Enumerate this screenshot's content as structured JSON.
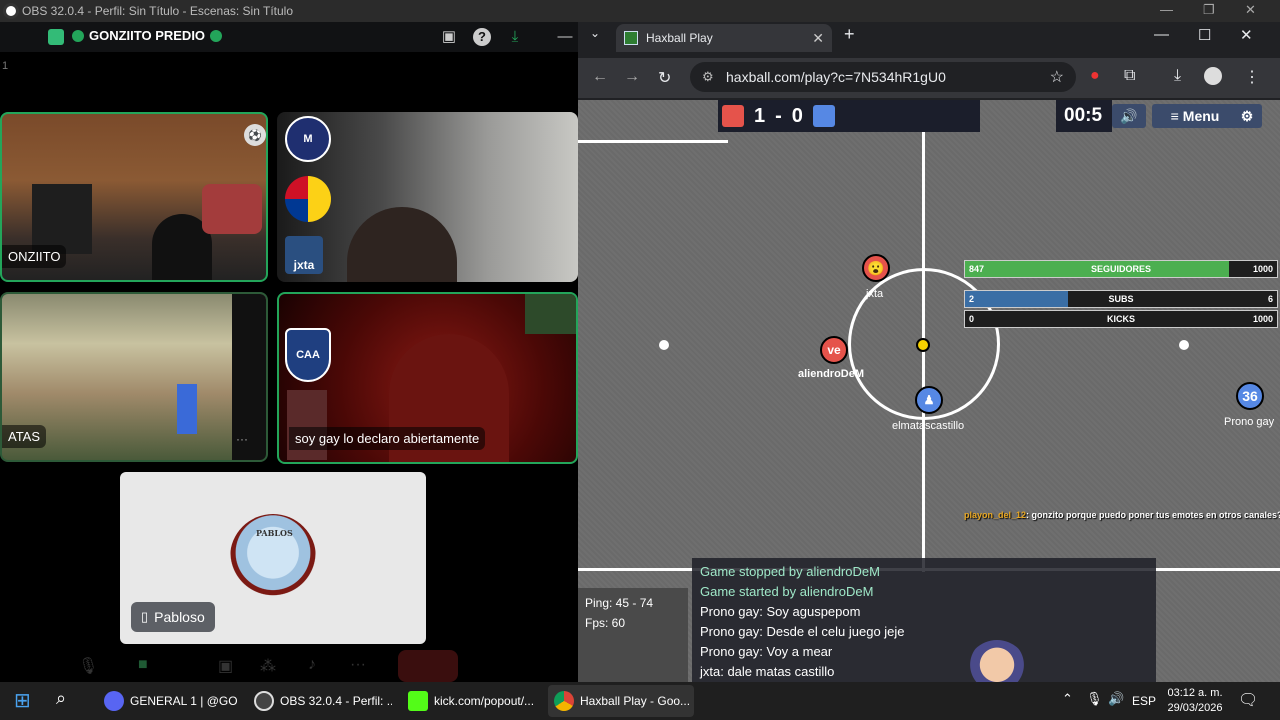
{
  "obs": {
    "title": "OBS 32.0.4 - Perfil: Sin Título - Escenas: Sin Título",
    "minimize": "—",
    "restore": "❐",
    "close": "✕"
  },
  "discord": {
    "channel_suffix": "1",
    "user_name": "GONZIITO PREDIO",
    "tiles": [
      {
        "name": "ONZIITO"
      },
      {
        "name": "jxta"
      },
      {
        "name": "ATAS"
      },
      {
        "name": "soy gay lo declaro abiertamente"
      }
    ],
    "pabloso": {
      "name": "Pabloso",
      "avatar_text": "PABLOS"
    }
  },
  "browser": {
    "tab_title": "Haxball Play",
    "url": "haxball.com/play?c=7N534hR1gU0",
    "new_tab": "+",
    "minimize": "—",
    "maximize": "☐",
    "close": "✕"
  },
  "game": {
    "score_red": "1",
    "score_sep": "-",
    "score_blue": "0",
    "timer": "00:5",
    "menu_label": "Menu",
    "red_color": "#e5534b",
    "blue_color": "#5688e4",
    "players": [
      {
        "name": "jxta",
        "team": "red",
        "avatar": "😮"
      },
      {
        "name": "aliendroDeM",
        "team": "red",
        "avatar": "ve"
      },
      {
        "name": "elmatascastillo",
        "team": "blue",
        "avatar": "♟"
      },
      {
        "name": "Prono gay",
        "team": "blue",
        "avatar": "36"
      }
    ],
    "stats": [
      {
        "left": "847",
        "label": "SEGUIDORES",
        "right": "1000",
        "fill": 0.847,
        "color": "#4caf50"
      },
      {
        "left": "2",
        "label": "SUBS",
        "right": "6",
        "fill": 0.33,
        "color": "#3a6ea5"
      },
      {
        "left": "0",
        "label": "KICKS",
        "right": "1000",
        "fill": 0,
        "color": "#3a6ea5"
      }
    ],
    "twitch_chat": {
      "user": "playon_del_12",
      "message": ": gonzito porque puedo poner tus emotes en otros canales?"
    },
    "ping": "Ping: 45 - 74",
    "fps": "Fps: 60",
    "chat": [
      {
        "text": "Game stopped by aliendroDeM",
        "system": true
      },
      {
        "text": "Game started by aliendroDeM",
        "system": true
      },
      {
        "text": "Prono gay: Soy aguspepom",
        "system": false
      },
      {
        "text": "Prono gay: Desde el celu juego jeje",
        "system": false
      },
      {
        "text": "Prono gay: Voy a mear",
        "system": false
      },
      {
        "text": "jxta: dale matas castillo",
        "system": false
      }
    ]
  },
  "taskbar": {
    "items": [
      {
        "label": "GENERAL 1 | @GO...",
        "color": "#5865f2"
      },
      {
        "label": "OBS 32.0.4 - Perfil: ...",
        "color": "#444"
      },
      {
        "label": "kick.com/popout/...",
        "color": "#53fc18"
      },
      {
        "label": "Haxball Play - Goo...",
        "color": "#4285f4"
      }
    ],
    "lang": "ESP",
    "time": "03:12 a. m.",
    "date": "29/03/2026"
  }
}
